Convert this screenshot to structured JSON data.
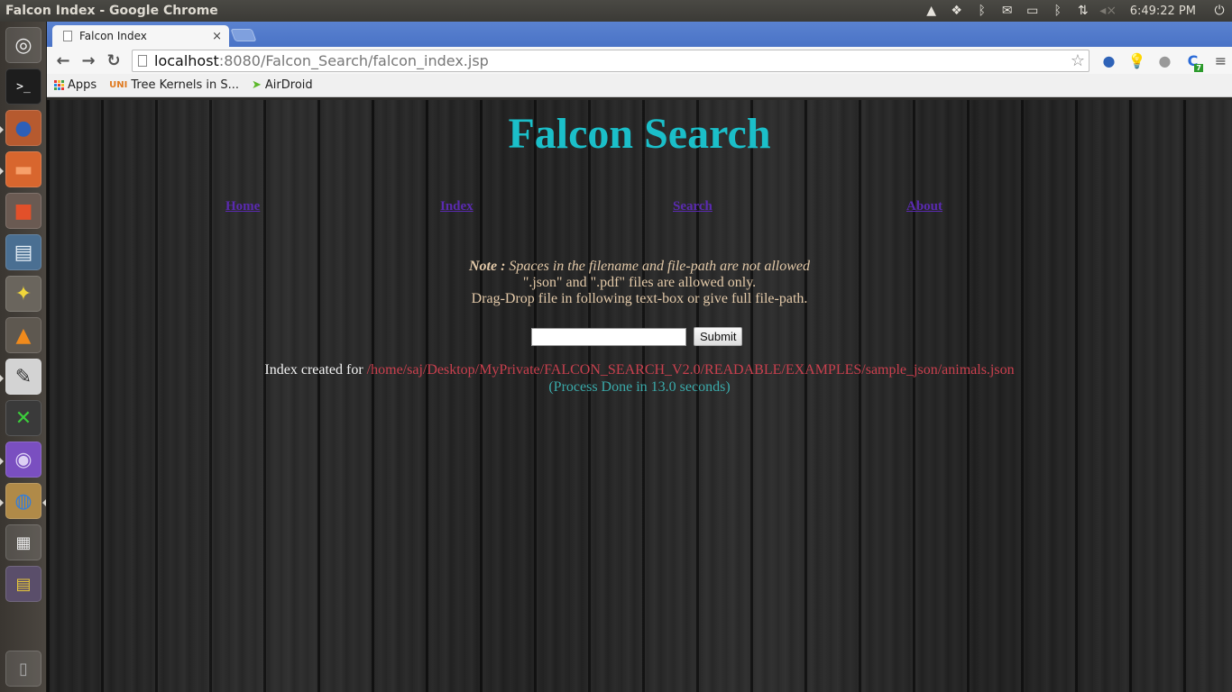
{
  "os": {
    "window_title": "Falcon Index - Google Chrome",
    "tray": {
      "icons": [
        "google-drive-icon",
        "dropbox-icon",
        "bluetooth-icon",
        "mail-icon",
        "battery-icon",
        "bluetooth-icon",
        "network-icon",
        "volume-muted-icon",
        "power-icon"
      ],
      "clock": "6:49:22 PM"
    },
    "launcher": [
      {
        "name": "ubuntu-dash",
        "glyph": "◎"
      },
      {
        "name": "terminal",
        "glyph": ">_"
      },
      {
        "name": "firefox",
        "glyph": "🦊"
      },
      {
        "name": "files",
        "glyph": "📁"
      },
      {
        "name": "software-center",
        "glyph": "🛍"
      },
      {
        "name": "libreoffice-impress",
        "glyph": "📄"
      },
      {
        "name": "bleachbit",
        "glyph": "🧹"
      },
      {
        "name": "vlc",
        "glyph": "🔺"
      },
      {
        "name": "text-editor",
        "glyph": "✎"
      },
      {
        "name": "x-app",
        "glyph": "✕"
      },
      {
        "name": "eclipse",
        "glyph": "◉"
      },
      {
        "name": "chrome",
        "glyph": "◍"
      },
      {
        "name": "workspace-switcher",
        "glyph": "▦"
      },
      {
        "name": "system-monitor",
        "glyph": "▤"
      },
      {
        "name": "trash",
        "glyph": "🗑"
      }
    ]
  },
  "browser": {
    "tab_title": "Falcon Index",
    "tab_close": "×",
    "url_host": "localhost",
    "url_path": ":8080/Falcon_Search/falcon_index.jsp",
    "bookmarks": [
      {
        "label": "Apps"
      },
      {
        "label": "Tree Kernels in S..."
      },
      {
        "label": "AirDroid"
      }
    ],
    "extension_badge": "7"
  },
  "page": {
    "title": "Falcon Search",
    "nav": [
      {
        "label": "Home"
      },
      {
        "label": "Index"
      },
      {
        "label": "Search"
      },
      {
        "label": "About"
      }
    ],
    "note": {
      "label": "Note :",
      "text": " Spaces in the filename and file-path are not allowed",
      "line2": "\".json\" and \".pdf\" files are allowed only.",
      "line3": "Drag-Drop file in following text-box or give full file-path."
    },
    "form": {
      "path_value": "",
      "submit_label": "Submit"
    },
    "result": {
      "label": "Index created for ",
      "path": "/home/saj/Desktop/MyPrivate/FALCON_SEARCH_V2.0/READABLE/EXAMPLES/sample_json/animals.json",
      "timing": "(Process Done in 13.0 seconds)"
    }
  }
}
